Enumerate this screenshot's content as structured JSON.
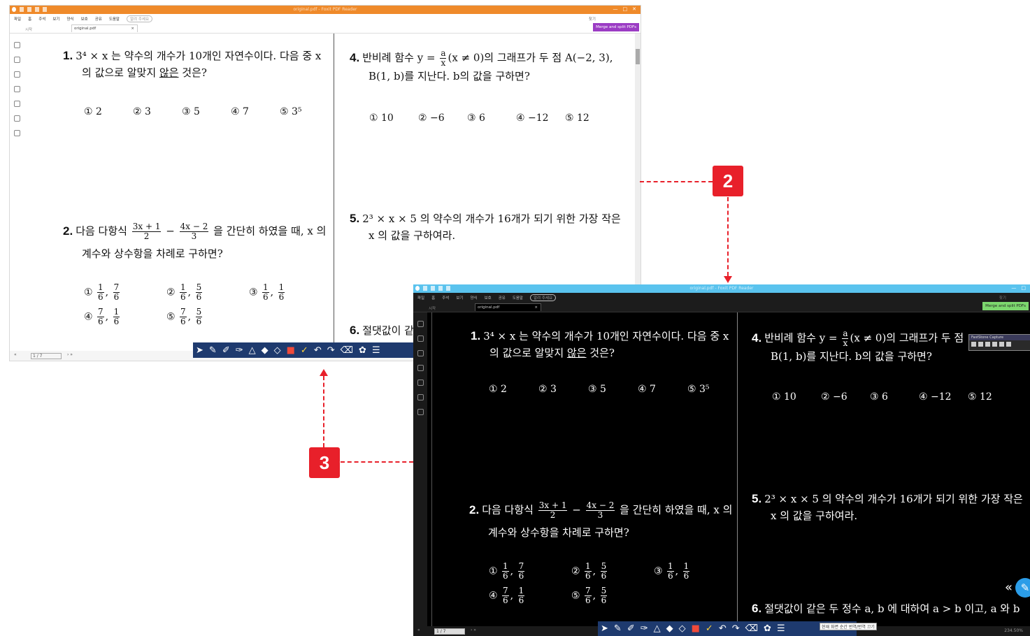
{
  "app": {
    "window_title": "original.pdf - Foxit PDF Reader",
    "menu": [
      "파일",
      "홈",
      "주석",
      "보기",
      "양식",
      "보호",
      "공유",
      "도움말"
    ],
    "tell_me": "알려 주세요",
    "search_placeholder": "찾기",
    "home_tab": "시작",
    "doc_tab": "original.pdf",
    "tab_close": "×",
    "merge_button": "Merge and split PDFs",
    "page_indicator": "1 / 7",
    "zoom_level": "234.50%",
    "tooltip": "현재 화면 순간 번역/번역 끄기",
    "faststone_title": "FastStone Capture"
  },
  "problems": {
    "p1": {
      "num": "1.",
      "line1": "3⁴ × x 는 약수의 개수가 10개인 자연수이다. 다음 중 x",
      "line2_a": "의 값으로 알맞지 ",
      "line2_u": "않은",
      "line2_b": " 것은?",
      "choices": [
        "① 2",
        "② 3",
        "③ 5",
        "④ 7",
        "⑤ 3⁵"
      ]
    },
    "p2": {
      "num": "2.",
      "pre": "다음 다항식",
      "f1n": "3x + 1",
      "f1d": "2",
      "minus": "−",
      "f2n": "4x − 2",
      "f2d": "3",
      "post": "을 간단히 하였을 때, x 의",
      "line2": "계수와 상수항을 차례로 구하면?",
      "choices": [
        {
          "mark": "①",
          "a_n": "1",
          "a_d": "6",
          "b_n": "7",
          "b_d": "6"
        },
        {
          "mark": "②",
          "a_n": "1",
          "a_d": "6",
          "b_n": "5",
          "b_d": "6"
        },
        {
          "mark": "③",
          "a_n": "1",
          "a_d": "6",
          "b_n": "1",
          "b_d": "6"
        },
        {
          "mark": "④",
          "a_n": "7",
          "a_d": "6",
          "b_n": "1",
          "b_d": "6"
        },
        {
          "mark": "⑤",
          "a_n": "7",
          "a_d": "6",
          "b_n": "5",
          "b_d": "6"
        }
      ]
    },
    "p4": {
      "num": "4.",
      "pre": "반비례 함수 y =",
      "fn": "a",
      "fd": "x",
      "post": "(x ≠ 0)의 그래프가 두 점 A(−2, 3),",
      "line2": "B(1, b)를 지난다. b의 값을 구하면?",
      "choices": [
        "① 10",
        "② −6",
        "③ 6",
        "④ −12",
        "⑤ 12"
      ],
      "post_cut": "(x ≠ 0)의 그래프가 두 점"
    },
    "p5": {
      "num": "5.",
      "line1": "2³ × x × 5 의 약수의 개수가 16개가 되기 위한 가장 작은",
      "line2": "x 의 값을 구하여라."
    },
    "p6": {
      "num": "6.",
      "cut1": "절댓값이 같",
      "full": "절댓값이 같은 두 정수 a, b 에 대하여 a > b 이고, a 와 b"
    }
  },
  "callouts": {
    "c2": "2",
    "c3": "3"
  },
  "toolbar_icons": [
    "select-icon",
    "highlighter-icon",
    "pen-icon",
    "pen-icon",
    "shapes-icon",
    "eraser-icon",
    "eraser-icon",
    "color-icon",
    "color-icon",
    "undo-icon",
    "redo-icon",
    "trash-icon",
    "palette-icon",
    "menu-icon"
  ],
  "colors": {
    "titlebar_original": "#ef8a2a",
    "titlebar_dark": "#5ac3ee",
    "merge_original": "#9b3cc4",
    "merge_dark": "#7cd76e",
    "callout": "#e8202a",
    "toolbar": "#1e3a6e"
  }
}
